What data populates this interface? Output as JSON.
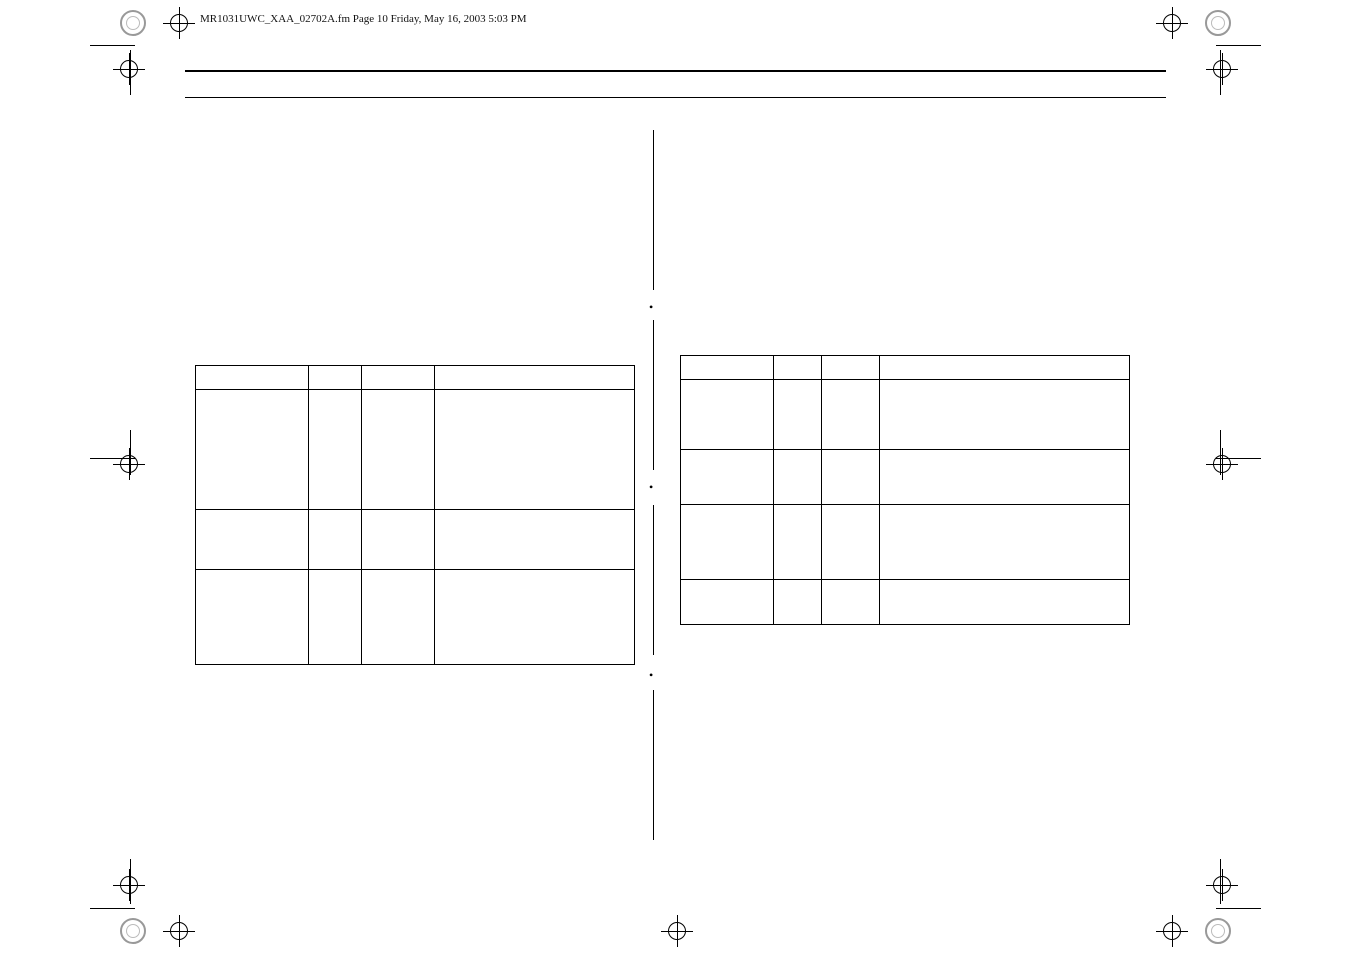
{
  "header": {
    "filename_line": "MR1031UWC_XAA_02702A.fm  Page 10  Friday, May 16, 2003  5:03 PM"
  },
  "left_table": {
    "rows": [
      [
        "",
        "",
        "",
        ""
      ],
      [
        "",
        "",
        "",
        ""
      ],
      [
        "",
        "",
        "",
        ""
      ],
      [
        "",
        "",
        "",
        ""
      ]
    ]
  },
  "right_table": {
    "rows": [
      [
        "",
        "",
        "",
        ""
      ],
      [
        "",
        "",
        "",
        ""
      ],
      [
        "",
        "",
        "",
        ""
      ],
      [
        "",
        "",
        "",
        ""
      ],
      [
        "",
        "",
        "",
        ""
      ]
    ]
  },
  "bullets": [
    "•",
    "•",
    "•"
  ]
}
